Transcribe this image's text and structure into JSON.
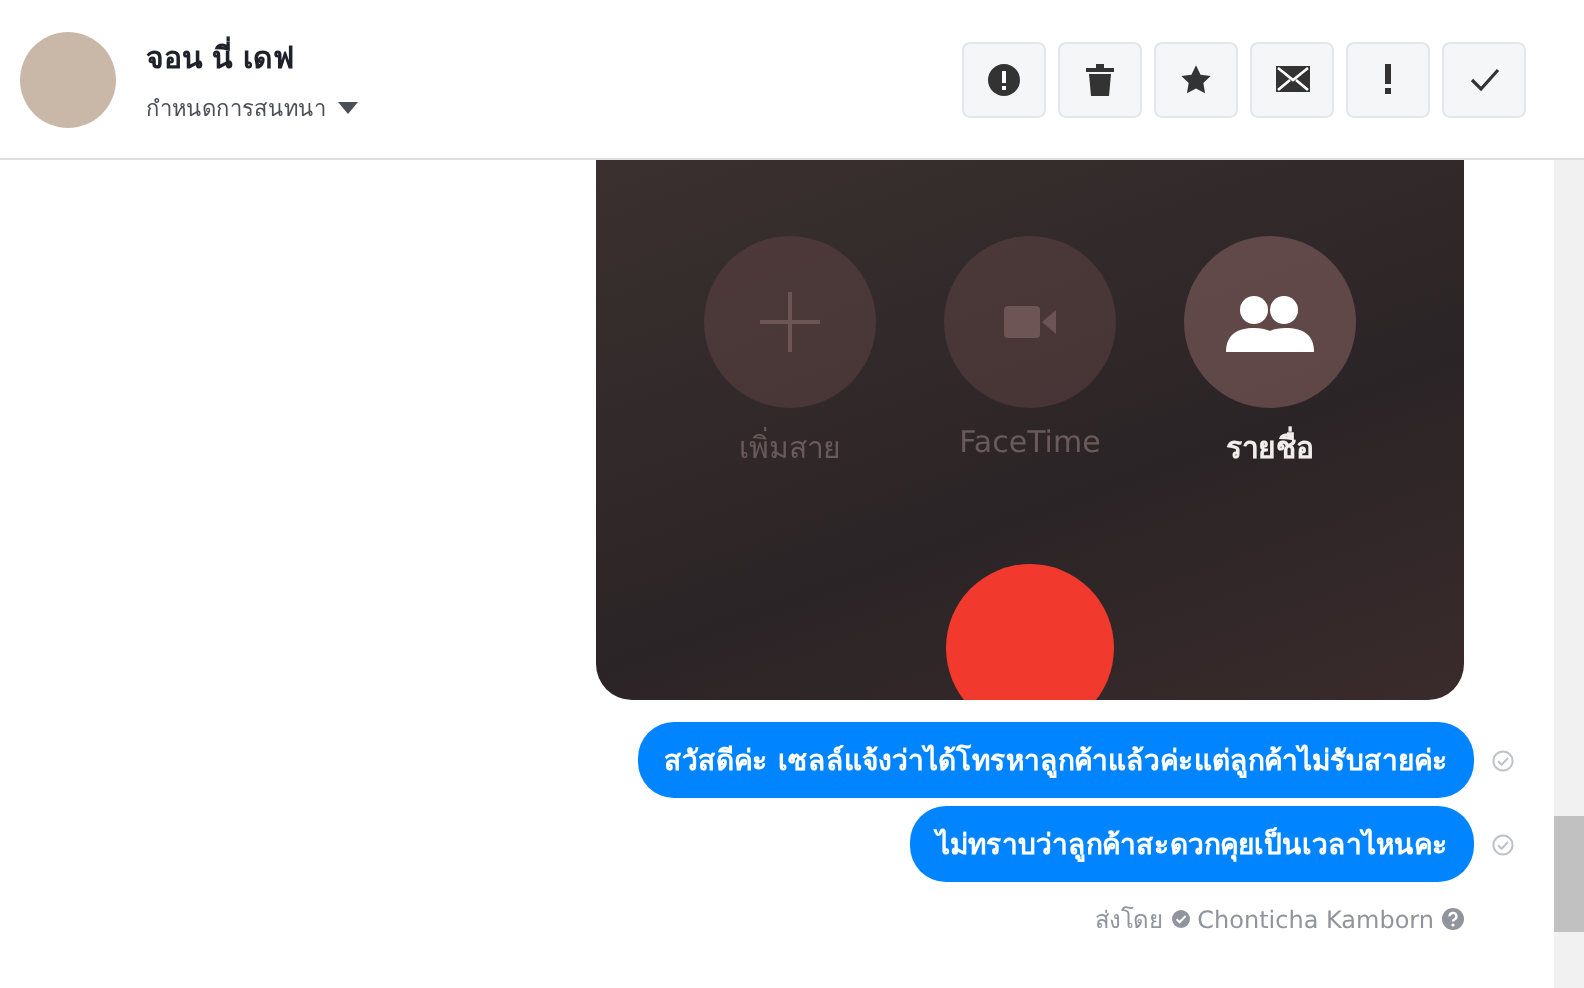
{
  "header": {
    "name": "จอน นี่ เดฟ",
    "subtitle": "กำหนดการสนทนา"
  },
  "actions": [
    {
      "kind": "alert"
    },
    {
      "kind": "trash"
    },
    {
      "kind": "star"
    },
    {
      "kind": "mail"
    },
    {
      "kind": "exclaim"
    },
    {
      "kind": "check"
    }
  ],
  "photo": {
    "call_buttons": [
      {
        "kind": "add",
        "label": "เพิ่มสาย",
        "disabled": true
      },
      {
        "kind": "video",
        "label": "FaceTime",
        "disabled": true
      },
      {
        "kind": "contacts",
        "label": "รายชื่อ",
        "disabled": false
      }
    ]
  },
  "messages": [
    {
      "text": "สวัสดีค่ะ เซลล์แจ้งว่าได้โทรหาลูกค้าแล้วค่ะแต่ลูกค้าไม่รับสายค่ะ"
    },
    {
      "text": "ไม่ทราบว่าลูกค้าสะดวกคุยเป็นเวลาไหนคะ"
    }
  ],
  "sent_by": {
    "label": "ส่งโดย",
    "name": "Chonticha Kamborn"
  }
}
